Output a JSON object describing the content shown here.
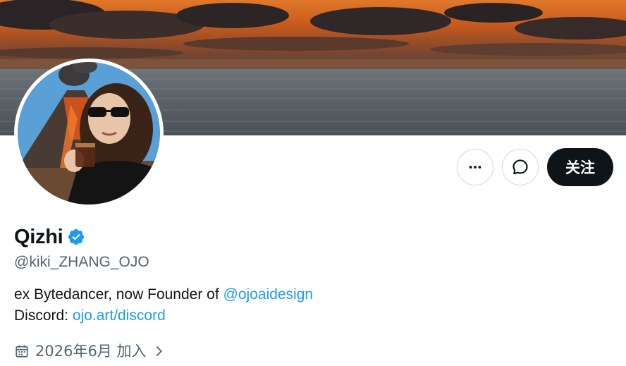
{
  "profile": {
    "display_name": "Qizhi",
    "handle": "@kiki_ZHANG_OJO",
    "verified_icon": "verified-badge-icon",
    "bio": {
      "line1_prefix": "ex Bytedancer, now Founder of ",
      "line1_mention": "@ojoaidesign",
      "line2_prefix": "Discord: ",
      "line2_link": "ojo.art/discord"
    },
    "joined": "2026年6月 加入"
  },
  "actions": {
    "more_icon": "more-icon",
    "message_icon": "message-icon",
    "follow_label": "关注"
  },
  "colors": {
    "link": "#1d9bf0",
    "verified": "#1d9bf0",
    "secondary_text": "#536471",
    "follow_bg": "#0f1419"
  }
}
